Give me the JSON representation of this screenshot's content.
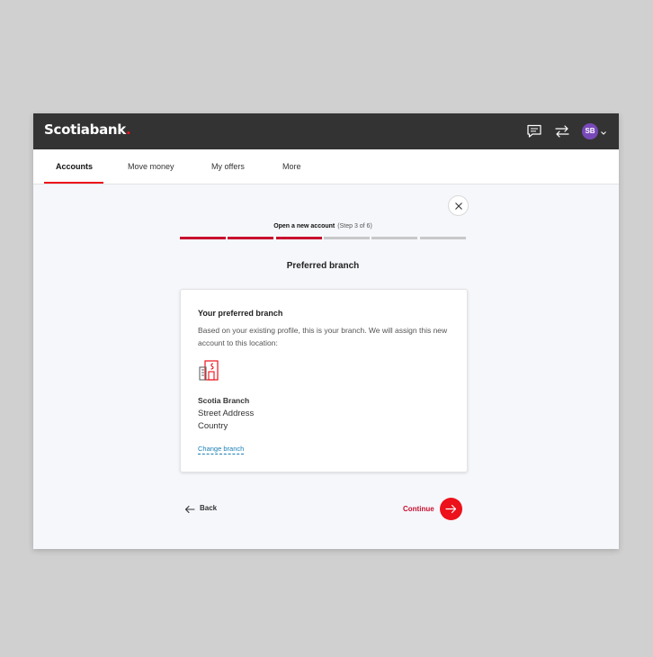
{
  "brand": {
    "name": "Scotiabank",
    "dot": "."
  },
  "header": {
    "avatar_initials": "SB",
    "icons": [
      "chat-icon",
      "transfer-icon",
      "chevron-down-icon"
    ]
  },
  "nav": {
    "items": [
      {
        "label": "Accounts",
        "active": true
      },
      {
        "label": "Move money",
        "active": false
      },
      {
        "label": "My offers",
        "active": false
      },
      {
        "label": "More",
        "active": false
      }
    ]
  },
  "stepper": {
    "label": "Open a new account",
    "step_text": "(Step 3 of 6)",
    "current_step": 3,
    "total_steps": 6
  },
  "page": {
    "title": "Preferred branch"
  },
  "card": {
    "title": "Your preferred branch",
    "description": "Based on your existing profile, this is your branch. We will assign this new account to this location:",
    "branch_name": "Scotia Branch",
    "address": "Street Address",
    "country": "Country",
    "change_link": "Change branch"
  },
  "footer": {
    "back_label": "Back",
    "continue_label": "Continue"
  },
  "colors": {
    "accent": "#ec111a",
    "progress_done": "#c8102e",
    "progress_pending": "#c8c8c8",
    "header_bg": "#333333",
    "avatar_bg": "#7849b8",
    "link": "#1a7fb5"
  }
}
